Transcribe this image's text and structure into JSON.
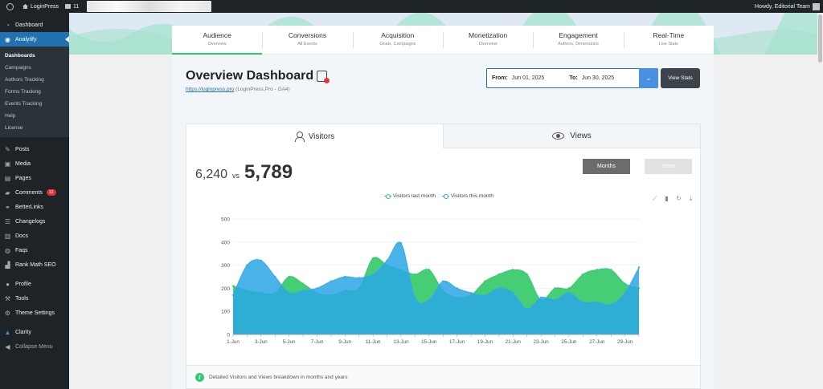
{
  "adminbar": {
    "site_name": "LoginPress",
    "comments_count": "11",
    "howdy": "Howdy, Editorial Team"
  },
  "sidebar": {
    "items_top": [
      {
        "label": "Dashboard",
        "icon": "dashboard-icon"
      },
      {
        "label": "Analytify",
        "icon": "analytify-icon"
      }
    ],
    "submenu": [
      "Dashboards",
      "Campaigns",
      "Authors Tracking",
      "Forms Tracking",
      "Events Tracking",
      "Help",
      "License"
    ],
    "items": [
      {
        "label": "Posts",
        "icon": "pin-icon"
      },
      {
        "label": "Media",
        "icon": "media-icon"
      },
      {
        "label": "Pages",
        "icon": "pages-icon"
      },
      {
        "label": "Comments",
        "icon": "comments-icon",
        "badge": "11"
      },
      {
        "label": "BetterLinks",
        "icon": "link-icon"
      },
      {
        "label": "Changelogs",
        "icon": "list-icon"
      },
      {
        "label": "Docs",
        "icon": "docs-icon"
      },
      {
        "label": "Faqs",
        "icon": "faq-icon"
      },
      {
        "label": "Rank Math SEO",
        "icon": "rankmath-icon"
      }
    ],
    "items_bottom": [
      {
        "label": "Profile",
        "icon": "user-icon"
      },
      {
        "label": "Tools",
        "icon": "tools-icon"
      },
      {
        "label": "Theme Settings",
        "icon": "gear-icon"
      }
    ],
    "clarity": "Clarity",
    "collapse": "Collapse Menu"
  },
  "tabs": [
    {
      "title": "Audience",
      "sub": "Overview"
    },
    {
      "title": "Conversions",
      "sub": "All Events"
    },
    {
      "title": "Acquisition",
      "sub": "Goals, Campaigns"
    },
    {
      "title": "Monetization",
      "sub": "Overview"
    },
    {
      "title": "Engagement",
      "sub": "Authors, Dimensions"
    },
    {
      "title": "Real-Time",
      "sub": "Live Stats"
    }
  ],
  "header": {
    "title": "Overview Dashboard",
    "site_link": "https://loginpress.pro",
    "site_suffix": " (LoginPress.Pro - GA4)"
  },
  "daterange": {
    "from_label": "From:",
    "from_value": "Jun 01, 2025",
    "to_label": "To:",
    "to_value": "Jun 30, 2025",
    "button": "View Stats"
  },
  "card": {
    "tab_visitors": "Visitors",
    "tab_views": "Views",
    "previous": "6,240",
    "vs": "vs",
    "current": "5,789",
    "btn_months": "Months",
    "btn_years": "Years",
    "info_text": "Detailed Visitors and Views breakdown in months and years"
  },
  "chart_data": {
    "type": "area",
    "x": [
      "1-Jun",
      "2-Jun",
      "3-Jun",
      "4-Jun",
      "5-Jun",
      "6-Jun",
      "7-Jun",
      "8-Jun",
      "9-Jun",
      "10-Jun",
      "11-Jun",
      "12-Jun",
      "13-Jun",
      "14-Jun",
      "15-Jun",
      "16-Jun",
      "17-Jun",
      "18-Jun",
      "19-Jun",
      "20-Jun",
      "21-Jun",
      "22-Jun",
      "23-Jun",
      "24-Jun",
      "25-Jun",
      "26-Jun",
      "27-Jun",
      "28-Jun",
      "29-Jun",
      "30-Jun"
    ],
    "xticks": [
      "1-Jun",
      "3-Jun",
      "5-Jun",
      "7-Jun",
      "9-Jun",
      "11-Jun",
      "13-Jun",
      "15-Jun",
      "17-Jun",
      "19-Jun",
      "21-Jun",
      "23-Jun",
      "25-Jun",
      "27-Jun",
      "29-Jun"
    ],
    "yticks": [
      0,
      100,
      200,
      300,
      400,
      500
    ],
    "ylim": [
      0,
      500
    ],
    "series": [
      {
        "name": "Visitors last month",
        "color": "#2ecc71",
        "values": [
          210,
          190,
          180,
          180,
          250,
          220,
          180,
          170,
          190,
          200,
          330,
          300,
          280,
          260,
          280,
          190,
          160,
          170,
          230,
          260,
          280,
          260,
          150,
          200,
          200,
          260,
          280,
          280,
          220,
          200
        ]
      },
      {
        "name": "Visitors this month",
        "color": "#3aa8e6",
        "values": [
          170,
          300,
          320,
          250,
          180,
          190,
          200,
          230,
          250,
          245,
          260,
          320,
          395,
          160,
          150,
          230,
          200,
          180,
          170,
          200,
          180,
          110,
          160,
          150,
          180,
          140,
          140,
          130,
          180,
          290
        ]
      }
    ]
  }
}
